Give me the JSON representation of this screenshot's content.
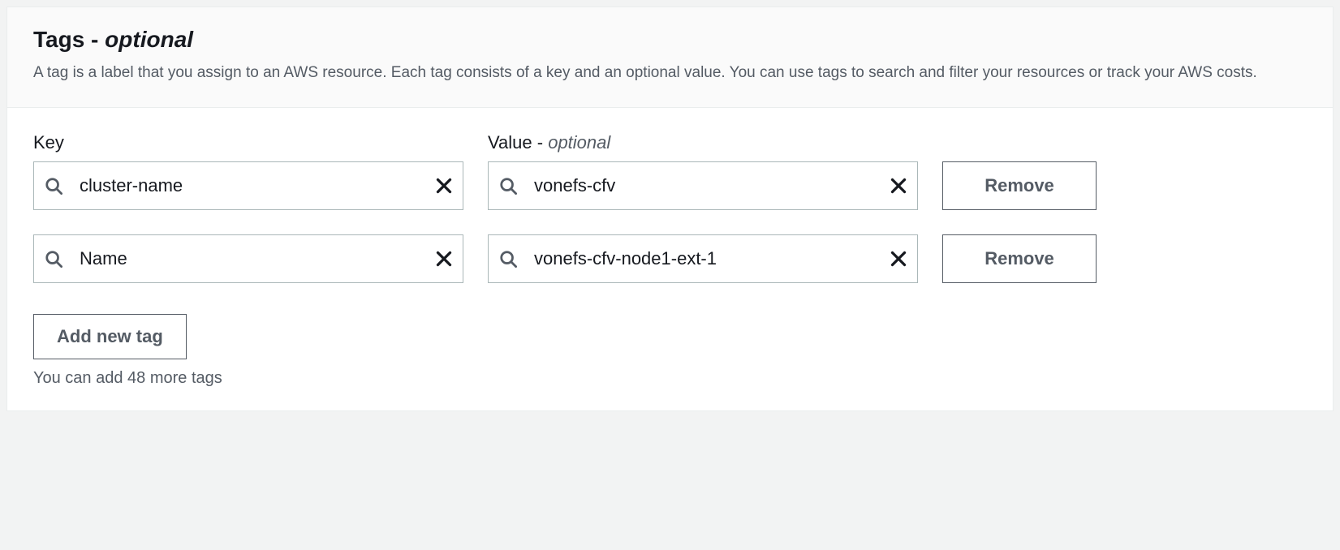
{
  "header": {
    "title_main": "Tags",
    "title_separator": " - ",
    "title_optional": "optional",
    "description": "A tag is a label that you assign to an AWS resource. Each tag consists of a key and an optional value. You can use tags to search and filter your resources or track your AWS costs."
  },
  "columns": {
    "key_label": "Key",
    "value_label_main": "Value",
    "value_label_separator": " - ",
    "value_label_optional": "optional"
  },
  "tags": [
    {
      "key": "cluster-name",
      "value": "vonefs-cfv"
    },
    {
      "key": "Name",
      "value": "vonefs-cfv-node1-ext-1"
    }
  ],
  "buttons": {
    "remove": "Remove",
    "add_new_tag": "Add new tag"
  },
  "hint": "You can add 48 more tags"
}
